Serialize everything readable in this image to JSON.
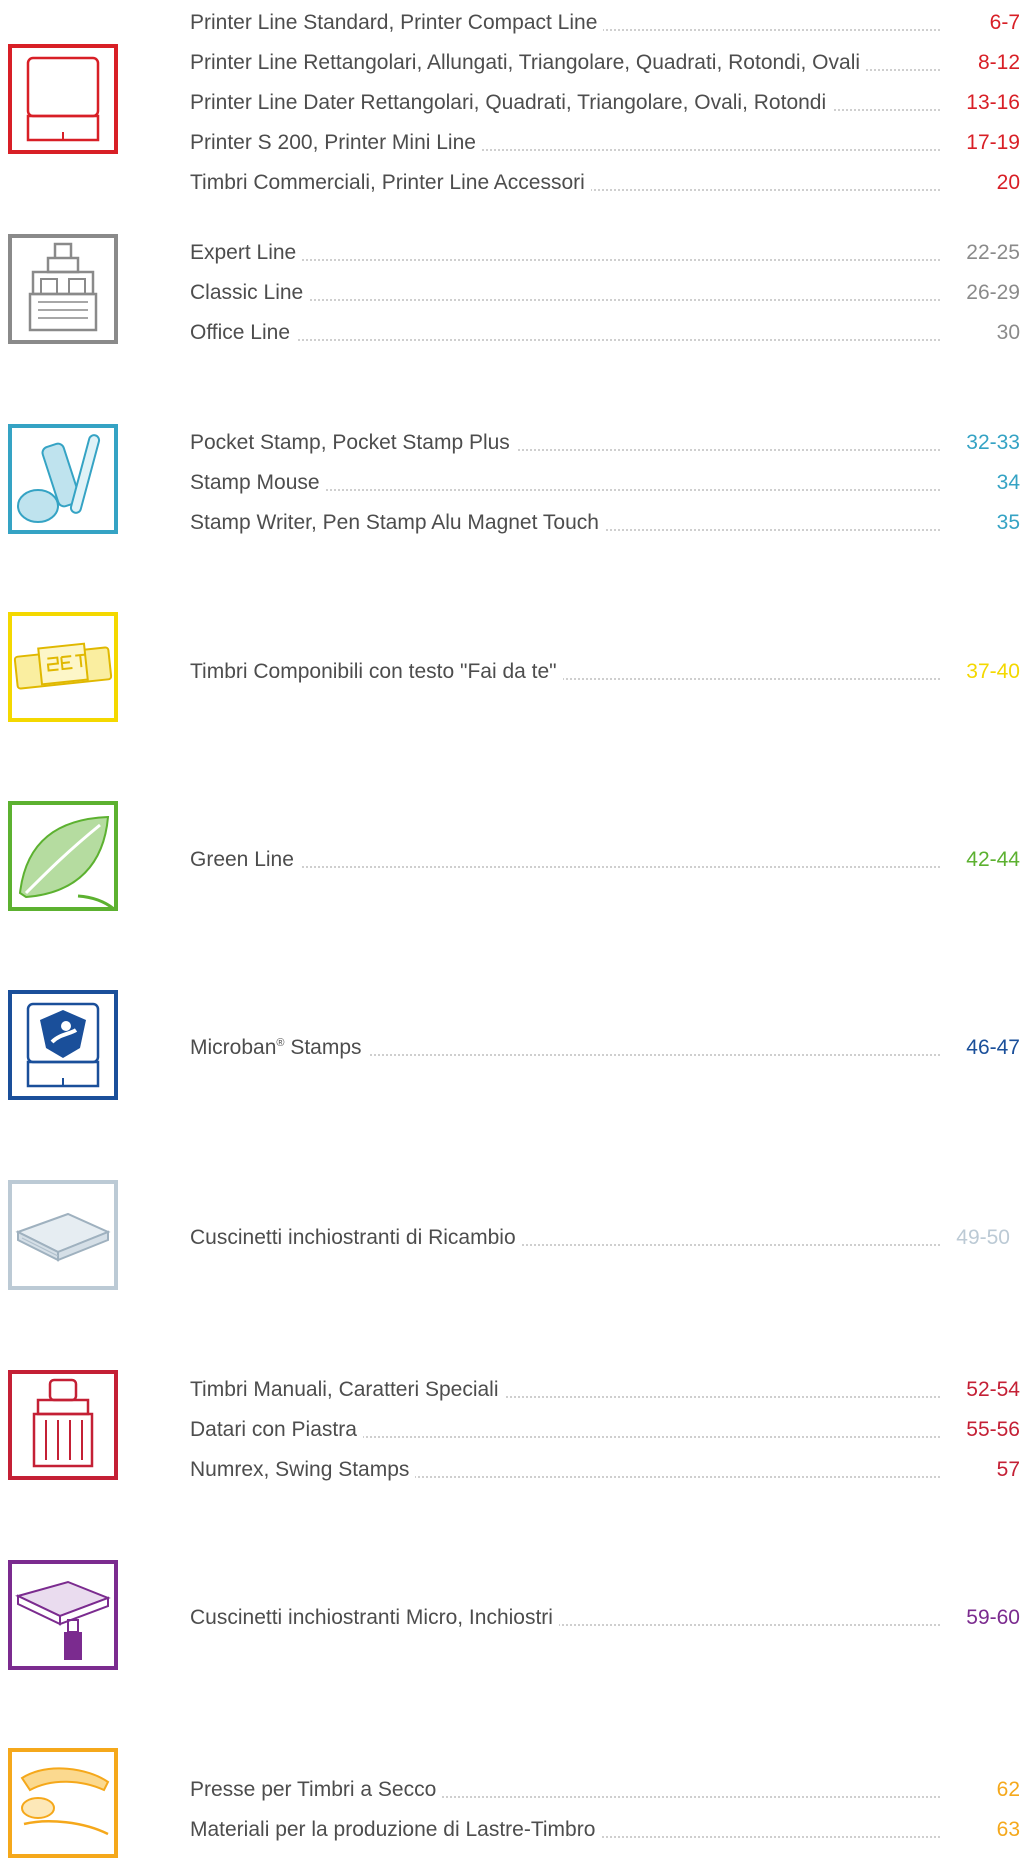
{
  "sections": [
    {
      "icon": "self-inking-stamp-icon",
      "color": "#d81f26",
      "rows": [
        {
          "title": "Printer Line Standard, Printer Compact Line",
          "page": "6-7"
        },
        {
          "title": "Printer Line Rettangolari, Allungati, Triangolare, Quadrati, Rotondi, Ovali",
          "page": "8-12"
        },
        {
          "title": "Printer Line Dater Rettangolari, Quadrati, Triangolare, Ovali, Rotondi",
          "page": "13-16"
        },
        {
          "title": "Printer S 200, Printer Mini Line",
          "page": "17-19"
        },
        {
          "title": "Timbri Commerciali, Printer Line Accessori",
          "page": "20"
        }
      ]
    },
    {
      "icon": "dater-stamp-icon",
      "color": "#8a8a8a",
      "rows": [
        {
          "title": "Expert Line",
          "page": "22-25"
        },
        {
          "title": "Classic Line",
          "page": "26-29"
        },
        {
          "title": "Office Line",
          "page": "30"
        }
      ]
    },
    {
      "icon": "pocket-stamp-icon",
      "color": "#35a3c4",
      "rows": [
        {
          "title": "Pocket Stamp, Pocket Stamp Plus",
          "page": "32-33"
        },
        {
          "title": "Stamp Mouse",
          "page": "34"
        },
        {
          "title": "Stamp Writer, Pen Stamp Alu Magnet Touch",
          "page": "35"
        }
      ]
    },
    {
      "icon": "set-stamp-icon",
      "color": "#f4d800",
      "rows": [
        {
          "title": "Timbri Componibili con testo \"Fai da te\"",
          "page": "37-40"
        }
      ]
    },
    {
      "icon": "leaf-icon",
      "color": "#5cb130",
      "rows": [
        {
          "title": "Green Line",
          "page": "42-44"
        }
      ]
    },
    {
      "icon": "microban-stamp-icon",
      "color": "#1a4f9a",
      "rows": [
        {
          "title": "Microban",
          "sup": "®",
          "title_after": " Stamps",
          "page": "46-47"
        }
      ]
    },
    {
      "icon": "ink-pad-icon",
      "color": "#bccad5",
      "rows": [
        {
          "title": "Cuscinetti inchiostranti di Ricambio",
          "page": "49-50"
        }
      ]
    },
    {
      "icon": "hand-stamp-icon",
      "color": "#c42035",
      "rows": [
        {
          "title": "Timbri Manuali, Caratteri Speciali",
          "page": "52-54"
        },
        {
          "title": "Datari con Piastra",
          "page": "55-56"
        },
        {
          "title": "Numrex, Swing Stamps",
          "page": "57"
        }
      ]
    },
    {
      "icon": "ink-bottle-pad-icon",
      "color": "#7b2b8f",
      "rows": [
        {
          "title": "Cuscinetti inchiostranti Micro, Inchiostri",
          "page": "59-60"
        }
      ]
    },
    {
      "icon": "embosser-icon",
      "color": "#f5a81b",
      "rows": [
        {
          "title": "Presse per Timbri a Secco",
          "page": "62"
        },
        {
          "title": "Materiali per la produzione di Lastre-Timbro",
          "page": "63"
        }
      ]
    }
  ]
}
